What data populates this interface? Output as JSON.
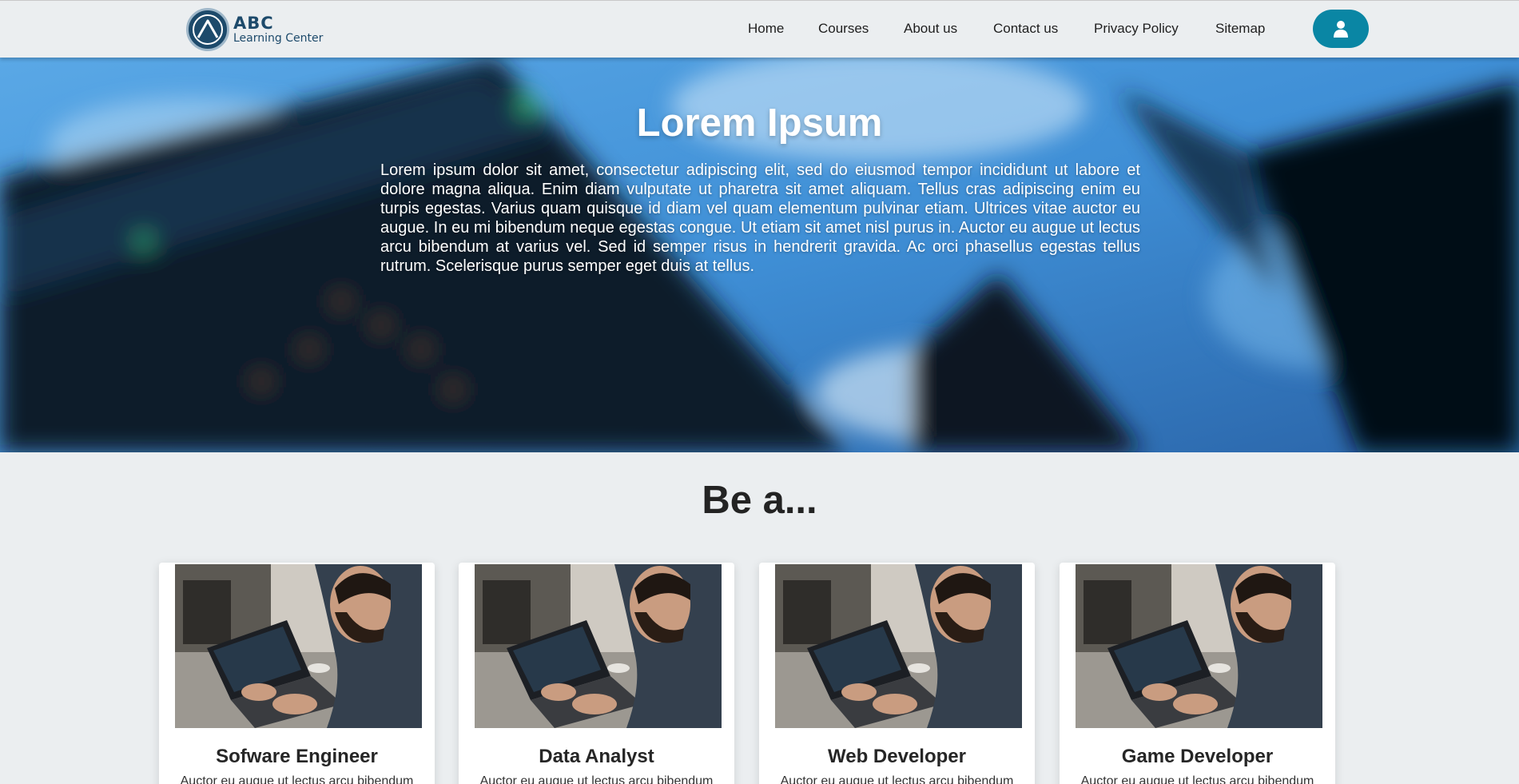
{
  "brand": {
    "name": "ABC",
    "subtitle": "Learning Center"
  },
  "nav": {
    "links": [
      "Home",
      "Courses",
      "About us",
      "Contact us",
      "Privacy Policy",
      "Sitemap"
    ],
    "user_icon": "user-icon"
  },
  "hero": {
    "title": "Lorem Ipsum",
    "body": "Lorem ipsum dolor sit amet, consectetur adipiscing elit, sed do eiusmod tempor incididunt ut labore et dolore magna aliqua. Enim diam vulputate ut pharetra sit amet aliquam. Tellus cras adipiscing enim eu turpis egestas. Varius quam quisque id diam vel quam elementum pulvinar etiam. Ultrices vitae auctor eu augue. In eu mi bibendum neque egestas congue. Ut etiam sit amet nisl purus in. Auctor eu augue ut lectus arcu bibendum at varius vel. Sed id semper risus in hendrerit gravida. Ac orci phasellus egestas tellus rutrum. Scelerisque purus semper eget duis at tellus."
  },
  "section": {
    "title": "Be a...",
    "cards": [
      {
        "title": "Sofware Engineer",
        "text": "Auctor eu augue ut lectus arcu bibendum"
      },
      {
        "title": "Data Analyst",
        "text": "Auctor eu augue ut lectus arcu bibendum"
      },
      {
        "title": "Web Developer",
        "text": "Auctor eu augue ut lectus arcu bibendum"
      },
      {
        "title": "Game Developer",
        "text": "Auctor eu augue ut lectus arcu bibendum"
      }
    ]
  },
  "colors": {
    "accent": "#0a86a4",
    "brand": "#1d4a6b",
    "background": "#ebeef0"
  }
}
